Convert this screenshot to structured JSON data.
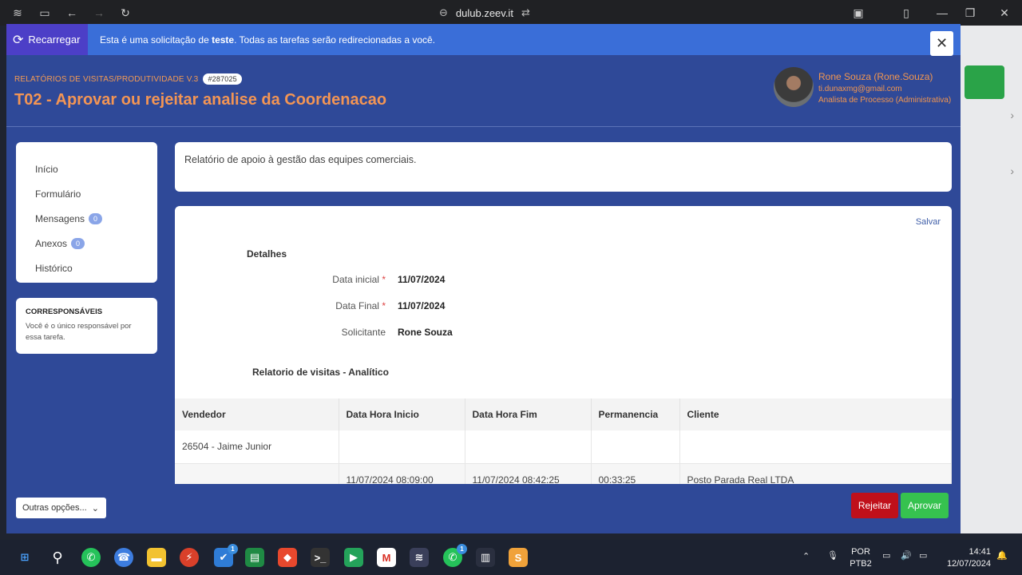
{
  "browser": {
    "url": "dulub.zeev.it"
  },
  "notice": {
    "reload_label": "Recarregar",
    "text_before": "Esta é uma solicitação de ",
    "text_bold": "teste",
    "text_after": ". Todas as tarefas serão redirecionadas a você.",
    "close_label": "✕"
  },
  "header": {
    "breadcrumb": "RELATÓRIOS DE VISITAS/PRODUTIVIDADE V.3",
    "request_id": "#287025",
    "title": "T02 - Aprovar ou rejeitar analise da Coordenacao",
    "user_name": "Rone Souza (Rone.Souza)",
    "user_email": "ti.dunaxmg@gmail.com",
    "user_role": "Analista de Processo (Administrativa)"
  },
  "sidebar": {
    "items": [
      {
        "label": "Início",
        "count": null
      },
      {
        "label": "Formulário",
        "count": null
      },
      {
        "label": "Mensagens",
        "count": "0"
      },
      {
        "label": "Anexos",
        "count": "0"
      },
      {
        "label": "Histórico",
        "count": null
      }
    ],
    "corresp_title": "CORRESPONSÁVEIS",
    "corresp_text": "Você é o único responsável por essa tarefa."
  },
  "description": "Relatório de apoio à gestão das equipes comerciais.",
  "form": {
    "save_label": "Salvar",
    "section_title": "Detalhes",
    "fields": [
      {
        "label": "Data inicial",
        "required": true,
        "value": "11/07/2024"
      },
      {
        "label": "Data Final",
        "required": true,
        "value": "11/07/2024"
      },
      {
        "label": "Solicitante",
        "required": false,
        "value": "Rone Souza"
      }
    ],
    "subsection_title": "Relatorio de visitas - Analítico",
    "table": {
      "headers": [
        "Vendedor",
        "Data Hora Inicio",
        "Data Hora Fim",
        "Permanencia",
        "Cliente"
      ],
      "rows": [
        [
          "26504 - Jaime Junior",
          "",
          "",
          "",
          ""
        ],
        [
          "",
          "11/07/2024 08:09:00",
          "11/07/2024 08:42:25",
          "00:33:25",
          "Posto Parada Real LTDA"
        ]
      ]
    }
  },
  "footer": {
    "more_options": "Outras opções...",
    "reject_label": "Rejeitar",
    "approve_label": "Aprovar"
  },
  "taskbar": {
    "lang_top": "POR",
    "lang_bottom": "PTB2",
    "time": "14:41",
    "date": "12/07/2024",
    "whatsapp_badge": "1",
    "todo_badge": "1"
  },
  "colors": {
    "modal_bg": "#2f4998",
    "accent_orange": "#f39554",
    "reject": "#c0101a",
    "approve": "#36c24f"
  }
}
